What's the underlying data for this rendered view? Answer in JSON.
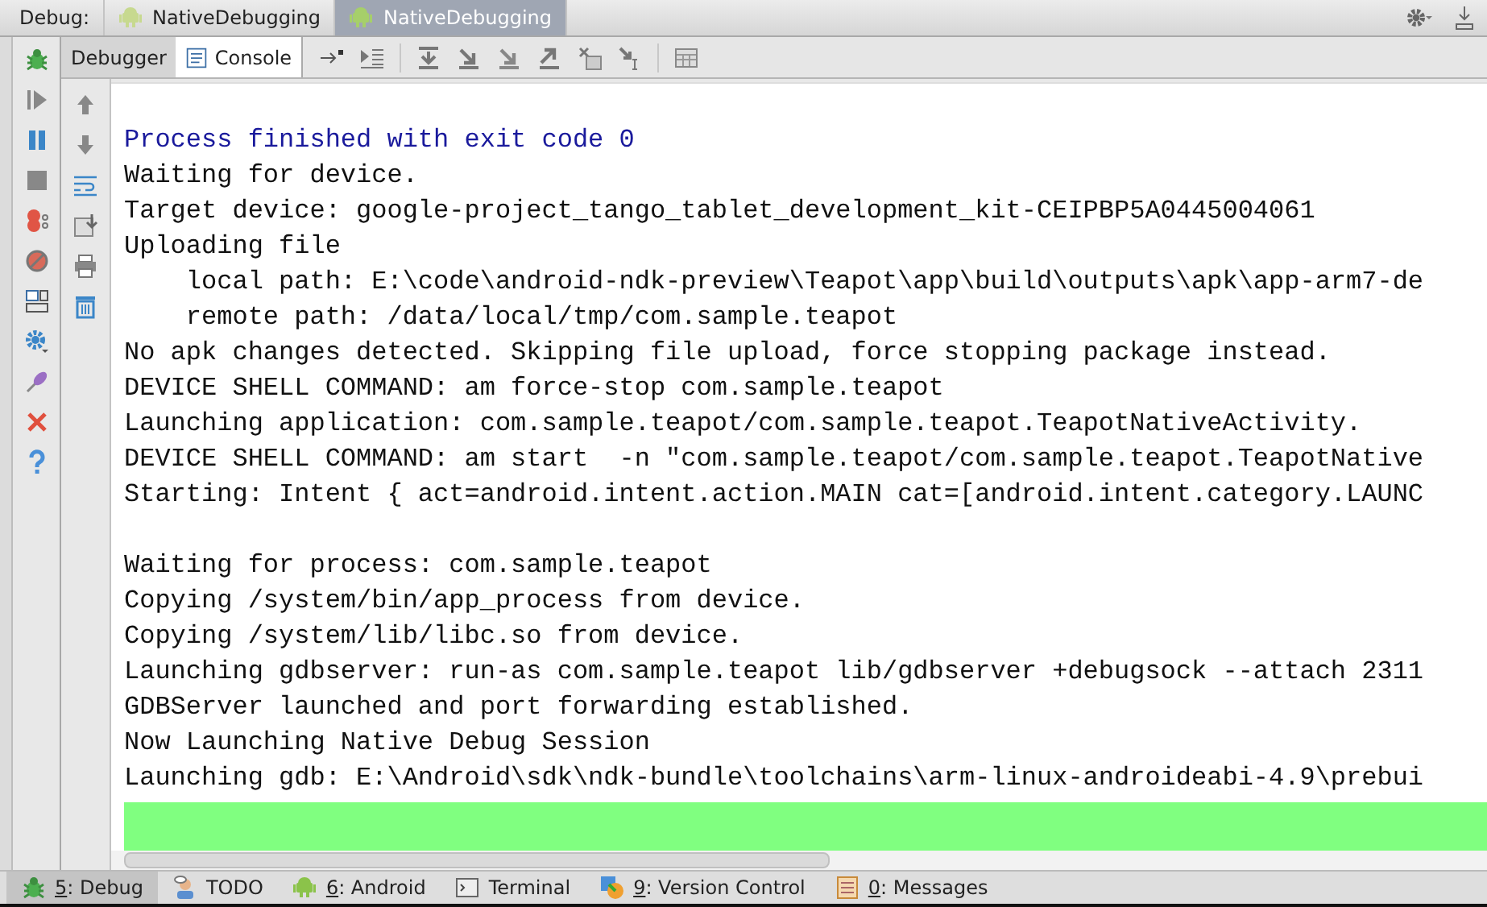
{
  "debug_bar": {
    "label": "Debug:",
    "tabs": [
      {
        "label": "NativeDebugging",
        "selected": false
      },
      {
        "label": "NativeDebugging",
        "selected": true
      }
    ]
  },
  "panel_tabs": [
    {
      "label": "Debugger",
      "selected": false
    },
    {
      "label": "Console",
      "selected": true
    }
  ],
  "console": {
    "blocks": [
      [
        {
          "text": "Process finished with exit code 0",
          "kind": "system"
        },
        {
          "text": "Waiting for device.",
          "kind": "output"
        },
        {
          "text": "Target device: google-project_tango_tablet_development_kit-CEIPBP5A0445004061",
          "kind": "output"
        },
        {
          "text": "Uploading file",
          "kind": "output"
        },
        {
          "text": "    local path: E:\\code\\android-ndk-preview\\Teapot\\app\\build\\outputs\\apk\\app-arm7-de",
          "kind": "output"
        },
        {
          "text": "    remote path: /data/local/tmp/com.sample.teapot",
          "kind": "output"
        },
        {
          "text": "No apk changes detected. Skipping file upload, force stopping package instead.",
          "kind": "output"
        },
        {
          "text": "DEVICE SHELL COMMAND: am force-stop com.sample.teapot",
          "kind": "output"
        },
        {
          "text": "Launching application: com.sample.teapot/com.sample.teapot.TeapotNativeActivity.",
          "kind": "output"
        },
        {
          "text": "DEVICE SHELL COMMAND: am start  -n \"com.sample.teapot/com.sample.teapot.TeapotNative",
          "kind": "output"
        },
        {
          "text": "Starting: Intent { act=android.intent.action.MAIN cat=[android.intent.category.LAUNC",
          "kind": "output"
        }
      ],
      [
        {
          "text": "Waiting for process: com.sample.teapot",
          "kind": "output"
        },
        {
          "text": "Copying /system/bin/app_process from device.",
          "kind": "output"
        },
        {
          "text": "Copying /system/lib/libc.so from device.",
          "kind": "output"
        },
        {
          "text": "Launching gdbserver: run-as com.sample.teapot lib/gdbserver +debugsock --attach 2311",
          "kind": "output"
        },
        {
          "text": "GDBServer launched and port forwarding established.",
          "kind": "output"
        },
        {
          "text": "Now Launching Native Debug Session",
          "kind": "output"
        },
        {
          "text": "Launching gdb: E:\\Android\\sdk\\ndk-bundle\\toolchains\\arm-linux-androideabi-4.9\\prebui",
          "kind": "output"
        }
      ]
    ]
  },
  "tool_windows": [
    {
      "key": "5",
      "label": ": Debug",
      "kind": "debug",
      "selected": true
    },
    {
      "label": "TODO",
      "kind": "todo",
      "selected": false
    },
    {
      "key": "6",
      "label": ": Android",
      "kind": "android",
      "selected": false
    },
    {
      "label": "Terminal",
      "kind": "terminal",
      "selected": false
    },
    {
      "key": "9",
      "label": ": Version Control",
      "kind": "vcs",
      "selected": false
    },
    {
      "key": "0",
      "label": ": Messages",
      "kind": "messages",
      "selected": false
    }
  ]
}
